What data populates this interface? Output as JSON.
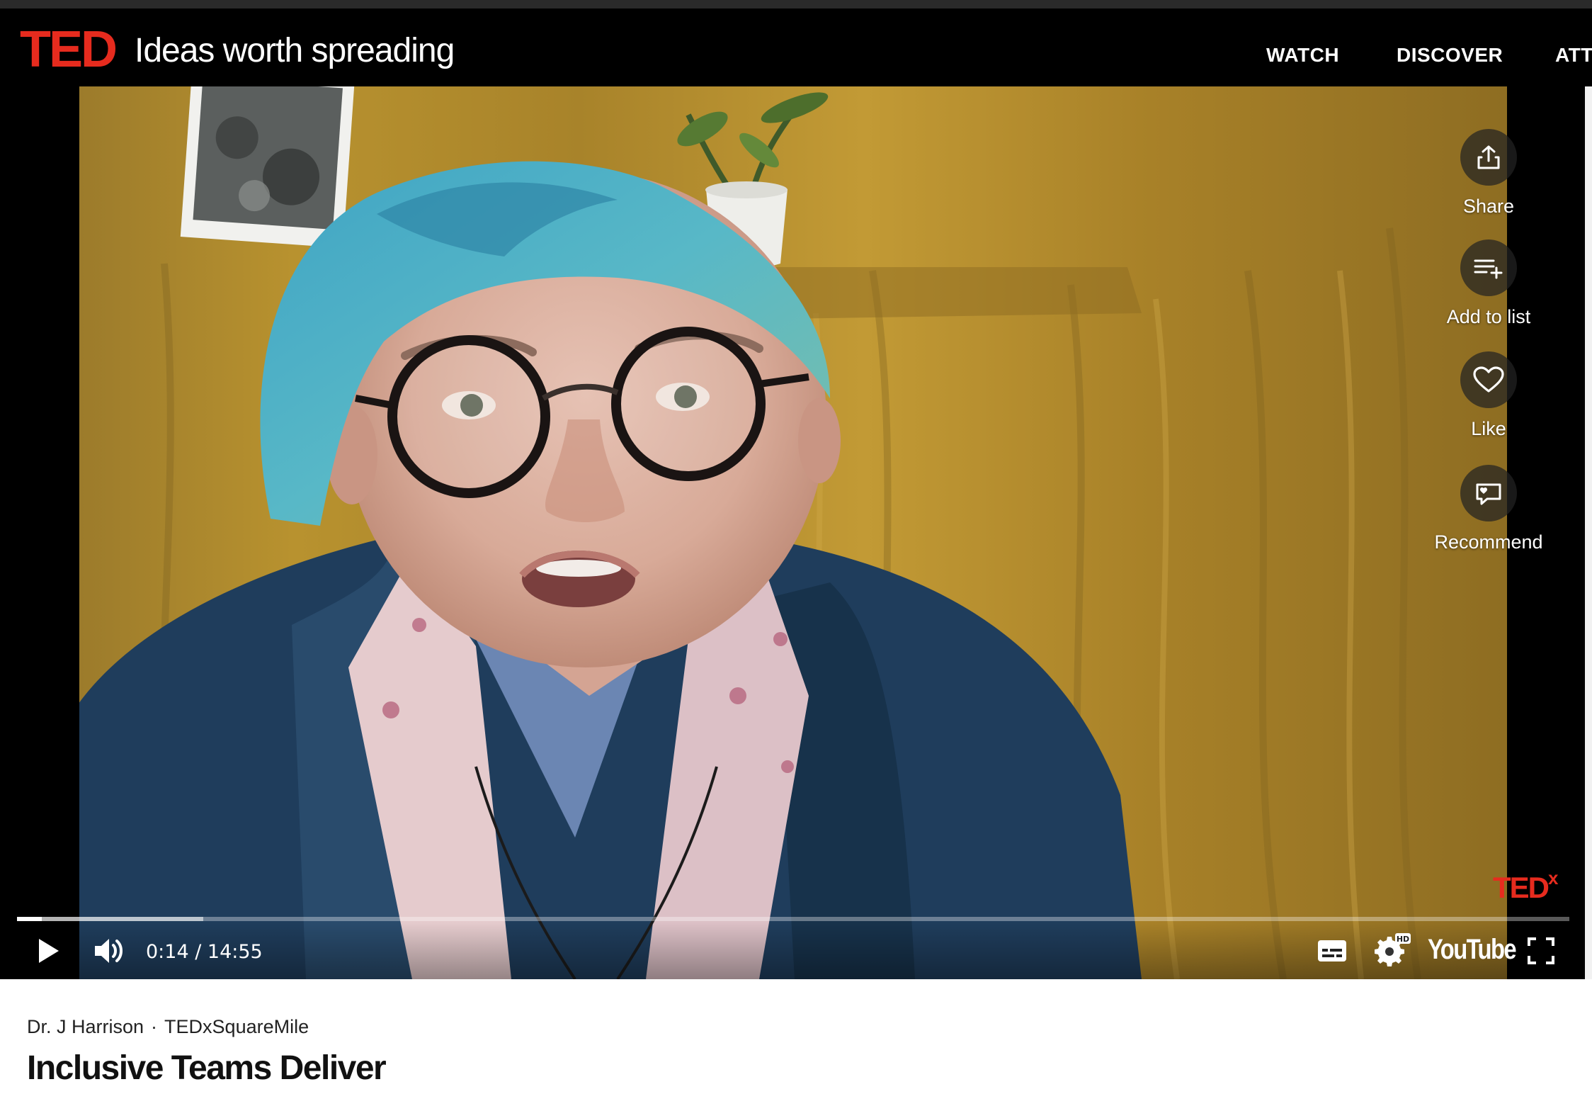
{
  "header": {
    "logo": "TED",
    "tagline": "Ideas worth spreading",
    "nav": [
      "WATCH",
      "DISCOVER",
      "ATT"
    ]
  },
  "actions": [
    {
      "label": "Share",
      "icon": "share-icon"
    },
    {
      "label": "Add to list",
      "icon": "playlist-add-icon"
    },
    {
      "label": "Like",
      "icon": "heart-icon"
    },
    {
      "label": "Recommend",
      "icon": "recommend-icon"
    }
  ],
  "watermark": {
    "text": "TED",
    "superscript": "x"
  },
  "player": {
    "time": "0:14 / 14:55",
    "progress_fraction": 0.016,
    "buffered_fraction": 0.12,
    "youtube_label": "YouTube",
    "hd_badge": "HD"
  },
  "talk": {
    "speaker": "Dr. J Harrison",
    "separator": "·",
    "event": "TEDxSquareMile",
    "title": "Inclusive Teams Deliver"
  },
  "colors": {
    "ted_red": "#e62b1e",
    "header_bg": "#000000",
    "backdrop": "#b08a2e"
  }
}
